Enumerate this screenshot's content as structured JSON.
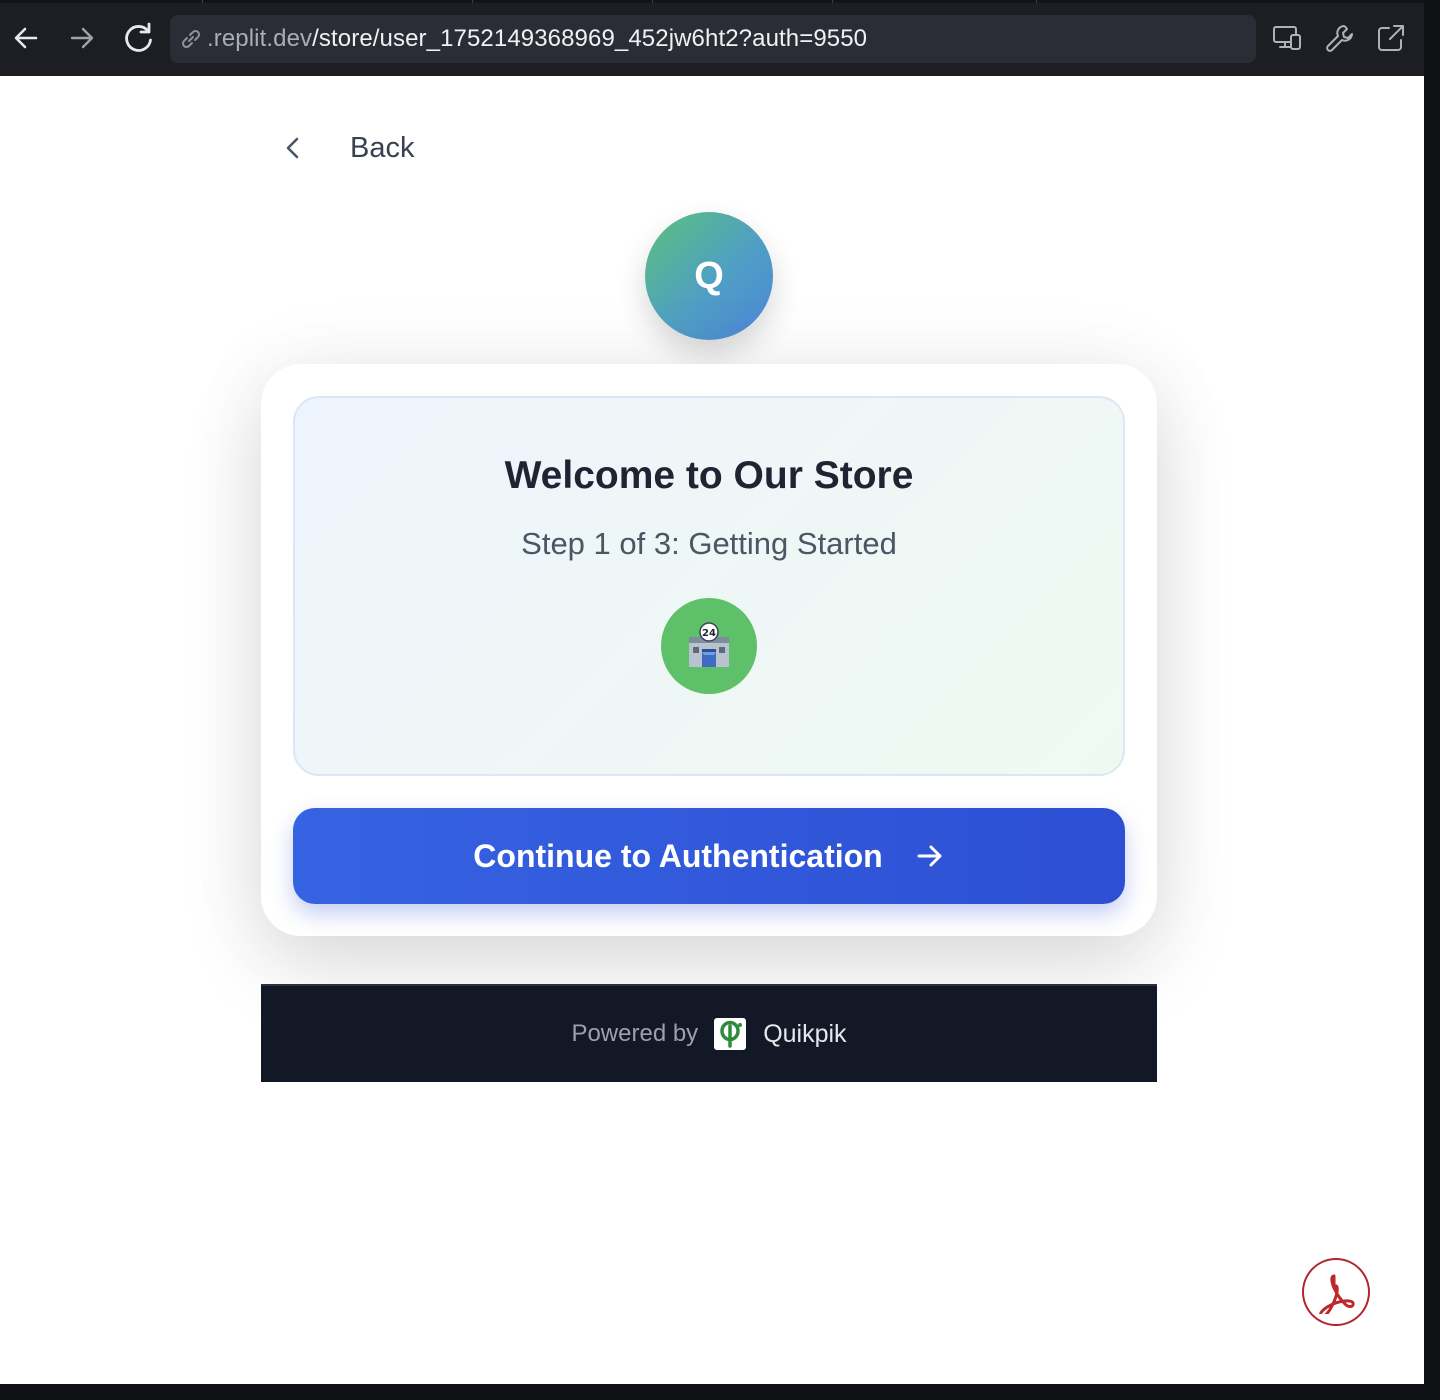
{
  "browser": {
    "url_domain": ".replit.dev",
    "url_path": "/store/user_1752149368969_452jw6ht2?auth=9550",
    "icons": [
      "arrow-left-icon",
      "arrow-right-icon",
      "reload-icon",
      "link-icon",
      "devices-icon",
      "wrench-icon",
      "external-link-icon"
    ]
  },
  "page": {
    "back_label": "Back",
    "logo_letter": "Q",
    "title": "Welcome to Our Store",
    "subtitle": "Step 1 of 3: Getting Started",
    "badge_icon": "convenience-store-icon",
    "badge_text": "24",
    "cta_label": "Continue to Authentication",
    "footer": {
      "powered_by": "Powered by",
      "brand": "Quikpik"
    },
    "fab_icon": "pdf-icon"
  },
  "colors": {
    "accent": "#3663e2",
    "logo_gradient_start": "#5cc17a",
    "logo_gradient_end": "#4e85d9",
    "badge_green": "#5fc06a",
    "footer_bg": "#121826",
    "pdf_red": "#c0272d"
  }
}
